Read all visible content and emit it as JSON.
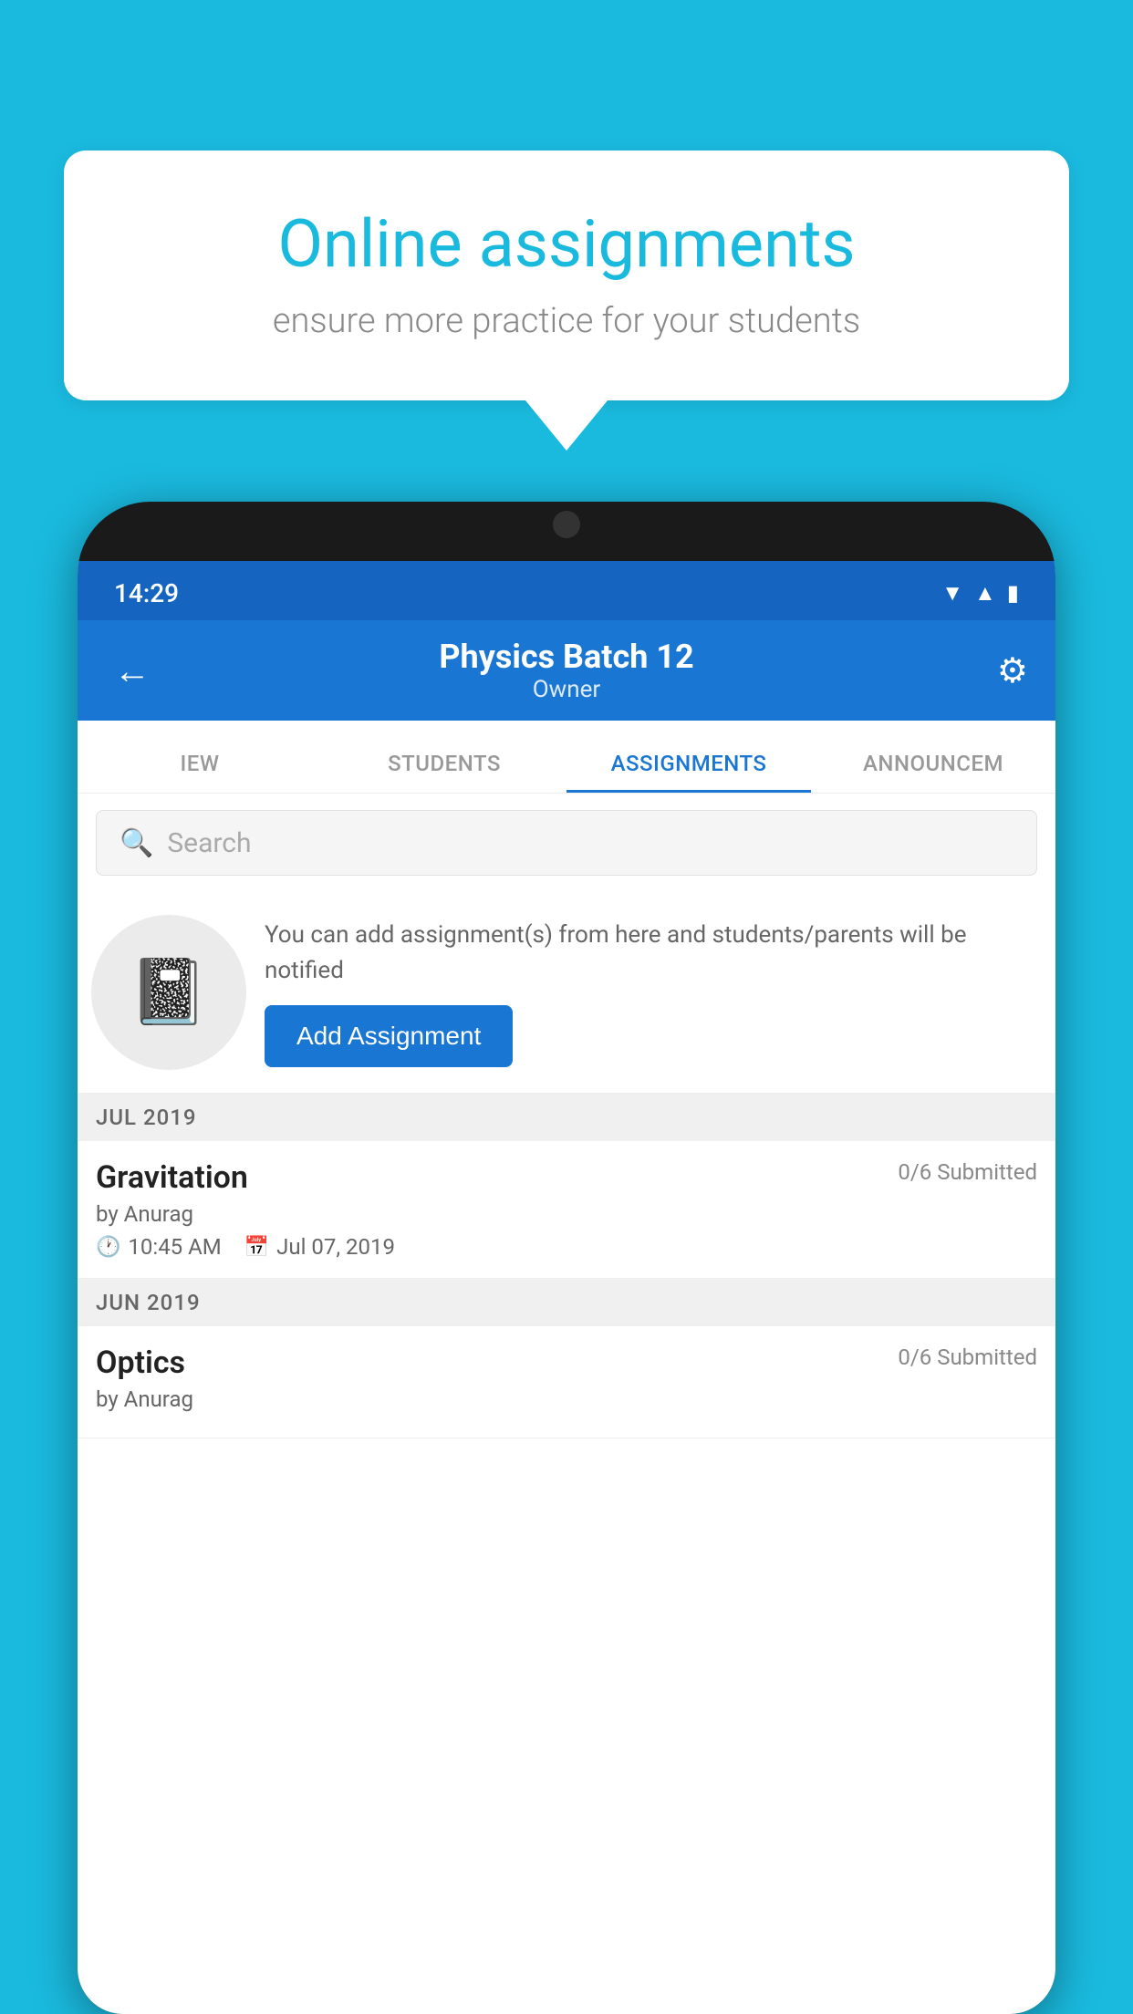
{
  "background_color": "#1ABADF",
  "speech_bubble": {
    "title": "Online assignments",
    "subtitle": "ensure more practice for your students"
  },
  "status_bar": {
    "time": "14:29",
    "icons": [
      "wifi",
      "signal",
      "battery"
    ]
  },
  "app_bar": {
    "title": "Physics Batch 12",
    "subtitle": "Owner",
    "back_label": "←",
    "settings_label": "⚙"
  },
  "tabs": [
    {
      "label": "IEW",
      "active": false
    },
    {
      "label": "STUDENTS",
      "active": false
    },
    {
      "label": "ASSIGNMENTS",
      "active": true
    },
    {
      "label": "ANNOUNCEM",
      "active": false
    }
  ],
  "search": {
    "placeholder": "Search"
  },
  "promo": {
    "icon": "📓",
    "text": "You can add assignment(s) from here and students/parents will be notified",
    "button_label": "Add Assignment"
  },
  "sections": [
    {
      "month": "JUL 2019",
      "assignments": [
        {
          "title": "Gravitation",
          "submitted": "0/6 Submitted",
          "by": "by Anurag",
          "time": "10:45 AM",
          "date": "Jul 07, 2019"
        }
      ]
    },
    {
      "month": "JUN 2019",
      "assignments": [
        {
          "title": "Optics",
          "submitted": "0/6 Submitted",
          "by": "by Anurag",
          "time": "",
          "date": ""
        }
      ]
    }
  ]
}
